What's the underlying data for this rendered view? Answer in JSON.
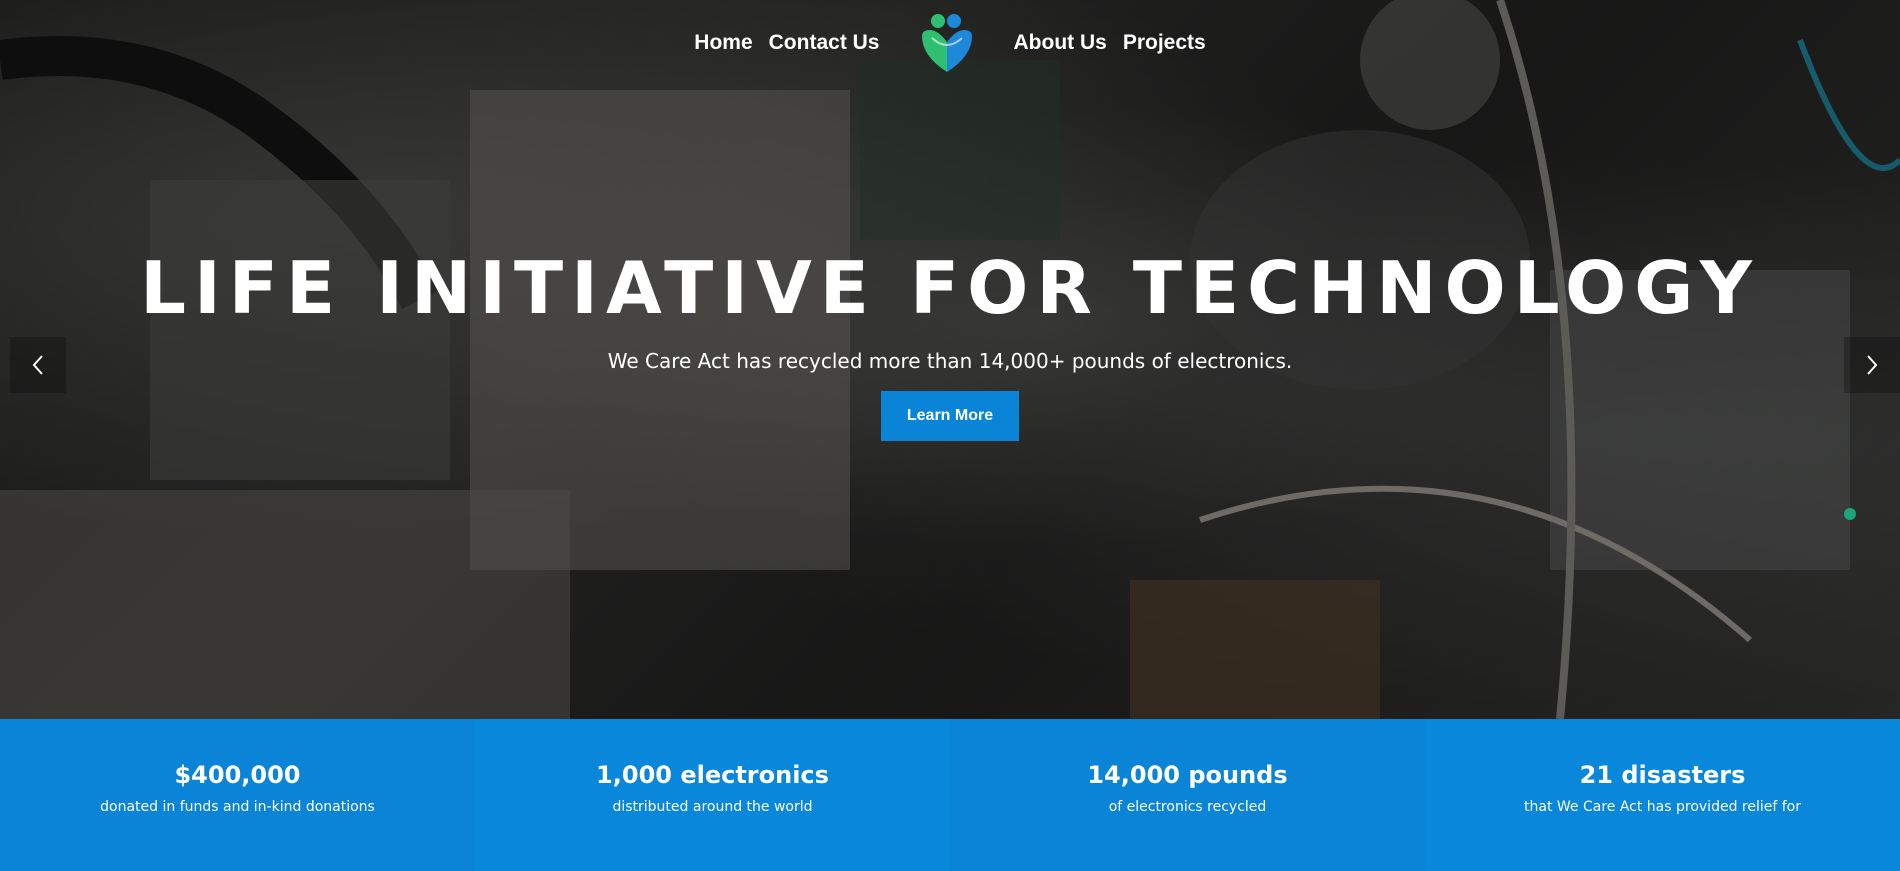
{
  "nav": {
    "left_links": [
      "Home",
      "Contact Us"
    ],
    "right_links": [
      "About Us",
      "Projects"
    ],
    "logo_icon": "heart-people-logo-icon"
  },
  "hero": {
    "title": "LIFE INITIATIVE FOR TECHNOLOGY",
    "subtitle": "We Care Act has recycled more than 14,000+ pounds of electronics.",
    "cta_label": "Learn More",
    "prev_icon": "chevron-left-icon",
    "next_icon": "chevron-right-icon"
  },
  "stats": [
    {
      "value": "$400,000",
      "label": "donated in funds and in-kind donations"
    },
    {
      "value": "1,000 electronics",
      "label": "distributed around the world"
    },
    {
      "value": "14,000 pounds",
      "label": "of electronics recycled"
    },
    {
      "value": "21 disasters",
      "label": "that We Care Act has provided relief for"
    }
  ],
  "colors": {
    "accent": "#0a84d6",
    "logo_blue": "#1e88d9",
    "logo_green": "#2fbf71"
  }
}
